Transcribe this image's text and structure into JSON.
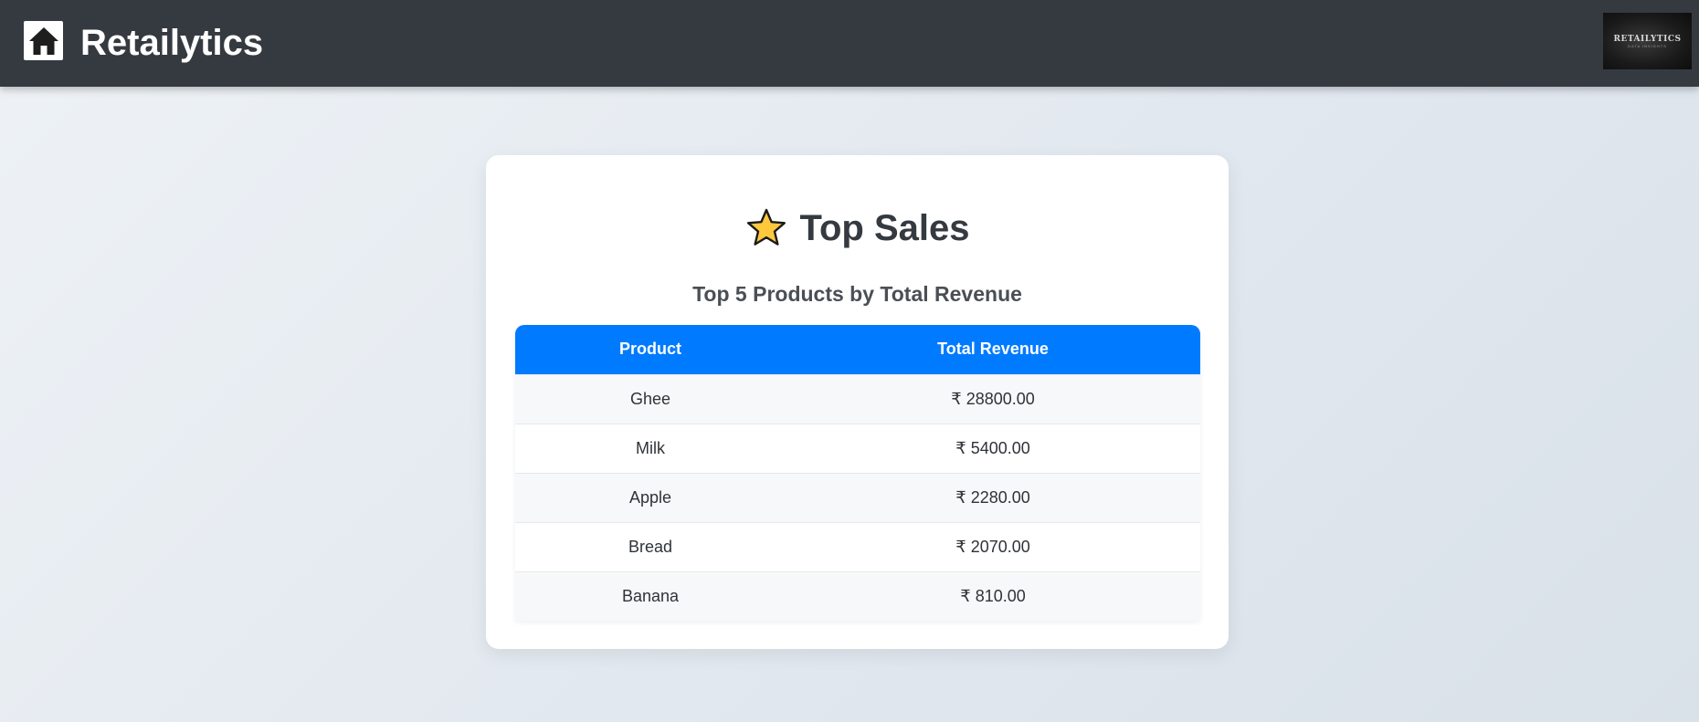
{
  "header": {
    "brand": "Retailytics",
    "logo_text": "RETAILYTICS",
    "logo_subtext": "DATA INSIGHTS"
  },
  "card": {
    "title": "Top Sales",
    "subtitle": "Top 5 Products by Total Revenue",
    "table": {
      "columns": [
        "Product",
        "Total Revenue"
      ],
      "rows": [
        {
          "product": "Ghee",
          "revenue": "₹ 28800.00"
        },
        {
          "product": "Milk",
          "revenue": "₹ 5400.00"
        },
        {
          "product": "Apple",
          "revenue": "₹ 2280.00"
        },
        {
          "product": "Bread",
          "revenue": "₹ 2070.00"
        },
        {
          "product": "Banana",
          "revenue": "₹ 810.00"
        }
      ]
    }
  },
  "colors": {
    "topbar": "#343a40",
    "table_header": "#007bff",
    "star": "#ffc83d"
  },
  "icons": {
    "home": "home-icon",
    "title": "star-icon"
  }
}
